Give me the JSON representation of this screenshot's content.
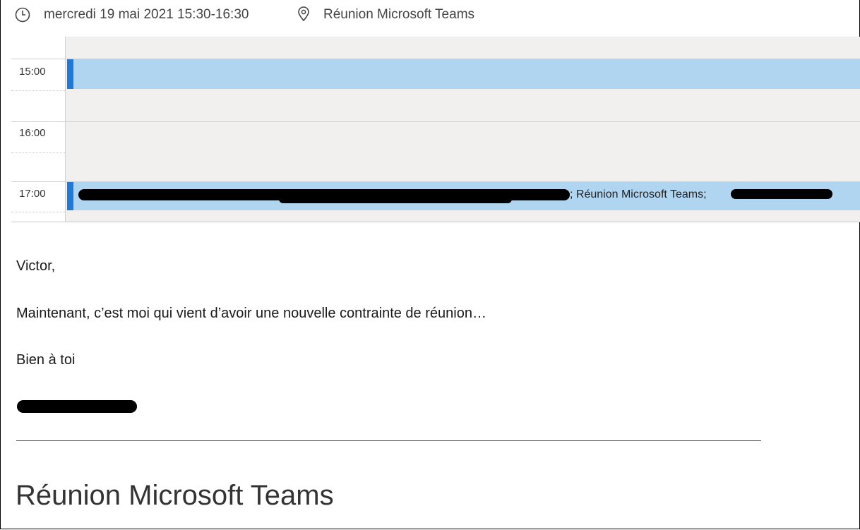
{
  "header": {
    "datetime": "mercredi 19 mai 2021 15:30-16:30",
    "location": "Réunion Microsoft Teams",
    "clock_icon": "clock-icon",
    "location_icon": "location-pin-icon"
  },
  "calendar": {
    "hours": [
      "15:00",
      "16:00",
      "17:00"
    ],
    "event_17": {
      "visible_text": "; Réunion Microsoft Teams;"
    }
  },
  "message": {
    "greeting": "Victor,",
    "line1": "Maintenant, c’est moi qui vient d’avoir une nouvelle contrainte de réunion…",
    "closing": "Bien à toi",
    "separator": "________________________________________________________________________________"
  },
  "meeting": {
    "title": "Réunion Microsoft Teams"
  },
  "colors": {
    "event_fill": "#b0d5f1",
    "event_bar": "#1e7ad6",
    "grid_bg": "#f1f0ef"
  }
}
